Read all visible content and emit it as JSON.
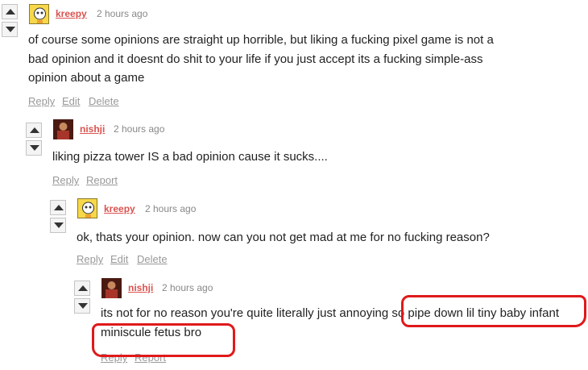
{
  "icons": {
    "upvote": "up-arrow-icon",
    "downvote": "down-arrow-icon"
  },
  "colors": {
    "username": "#d9534f",
    "annotation": "#e0191a",
    "timestamp": "#888888",
    "action": "#999999"
  },
  "comments": [
    {
      "username": "kreepy",
      "time": "2 hours ago",
      "lines": [
        "of course some opinions are straight up horrible, but liking a fucking pixel game is not a",
        "bad opinion and it doesnt do shit to your life if you just accept its a fucking simple-ass",
        "opinion about a game"
      ],
      "actions": [
        "Reply",
        "Edit",
        "Delete"
      ]
    },
    {
      "username": "nishji",
      "time": "2 hours ago",
      "lines": [
        "liking pizza tower IS a bad opinion cause it sucks...."
      ],
      "actions": [
        "Reply",
        "Report"
      ]
    },
    {
      "username": "kreepy",
      "time": "2 hours ago",
      "lines": [
        "ok, thats your opinion. now can you not get mad at me for no fucking reason?"
      ],
      "actions": [
        "Reply",
        "Edit",
        "Delete"
      ]
    },
    {
      "username": "nishji",
      "time": "2 hours ago",
      "lines": [
        "its not for no reason you're quite literally just annoying so pipe down lil tiny baby infant",
        "miniscule fetus bro"
      ],
      "actions": [
        "Reply",
        "Report"
      ]
    }
  ]
}
